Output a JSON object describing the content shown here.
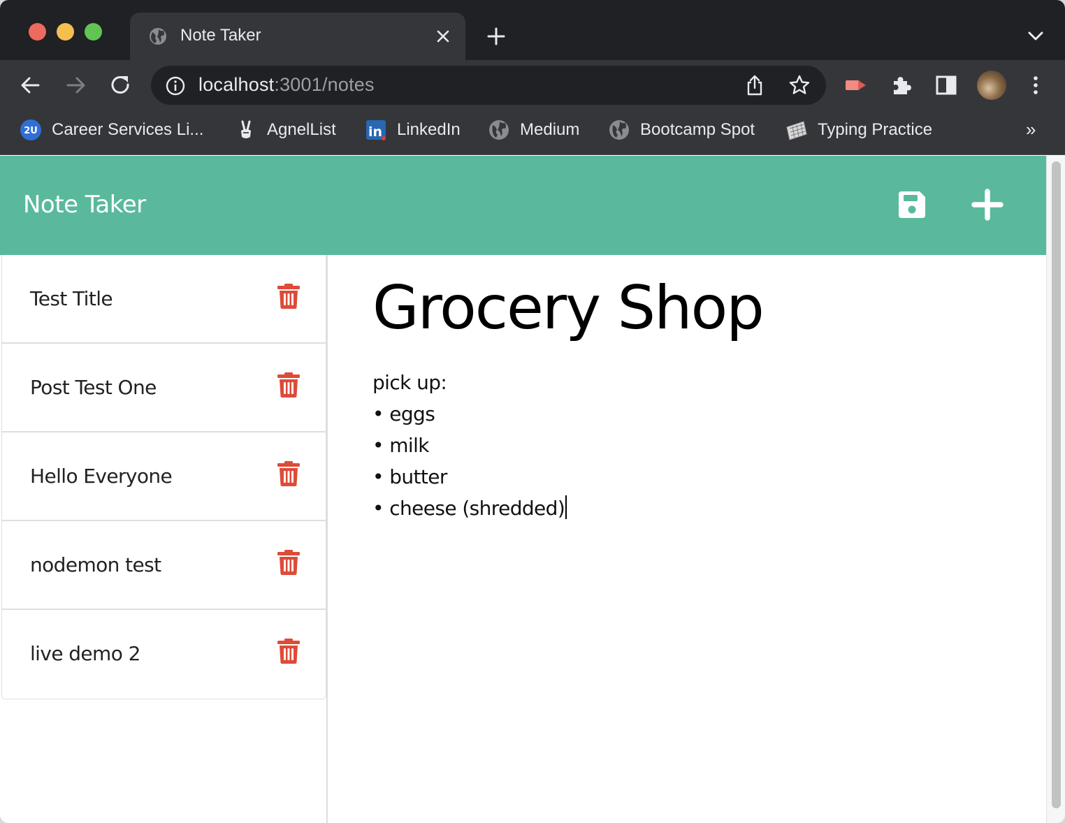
{
  "browser": {
    "tab_title": "Note Taker",
    "url_host": "localhost",
    "url_rest": ":3001/notes",
    "bookmarks": [
      {
        "label": "Career Services Li...",
        "icon": "2u-icon"
      },
      {
        "label": "AgnelList",
        "icon": "peace-hand-icon"
      },
      {
        "label": "LinkedIn",
        "icon": "linkedin-icon"
      },
      {
        "label": "Medium",
        "icon": "globe-icon"
      },
      {
        "label": "Bootcamp Spot",
        "icon": "globe-icon"
      },
      {
        "label": "Typing Practice",
        "icon": "keyboard-icon"
      }
    ],
    "bookmarks_overflow": "»",
    "colors": {
      "tabstrip": "#202124",
      "toolbar": "#35363a",
      "text": "#e8eaed"
    }
  },
  "app": {
    "brand": "Note Taker",
    "header_color": "#5ab99d",
    "delete_color": "#dd4b39",
    "icons": {
      "save": "save-icon",
      "new_note": "plus-icon",
      "delete": "trash-icon"
    }
  },
  "notes": [
    {
      "title": "Test Title"
    },
    {
      "title": "Post Test One"
    },
    {
      "title": "Hello Everyone"
    },
    {
      "title": "nodemon test"
    },
    {
      "title": "live demo 2"
    }
  ],
  "active_note": {
    "title": "Grocery Shop",
    "lines": [
      "pick up:",
      "• eggs",
      "• milk",
      "• butter",
      "• cheese (shredded)"
    ]
  }
}
